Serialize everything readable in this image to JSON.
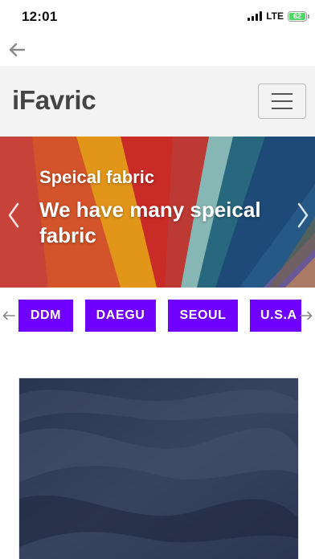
{
  "status_bar": {
    "time": "12:01",
    "network": "LTE",
    "battery": "62",
    "battery_color": "#4cd964"
  },
  "back": {
    "icon": "arrow-left-icon"
  },
  "navbar": {
    "brand": "iFavric",
    "menu_icon": "hamburger-menu-icon",
    "background": "#f3f3f3"
  },
  "carousel": {
    "slide_title": "Speical fabric",
    "slide_text": "We have many speical fabric",
    "prev_icon": "chevron-left-icon",
    "next_icon": "chevron-right-icon"
  },
  "locations": {
    "items": [
      "DDM",
      "DAEGU",
      "SEOUL",
      "U.S.A"
    ],
    "prev_icon": "arrow-left-icon",
    "next_icon": "arrow-right-icon",
    "chip_color": "#6f00ff"
  },
  "product": {
    "image": "navy-fabric-image"
  }
}
